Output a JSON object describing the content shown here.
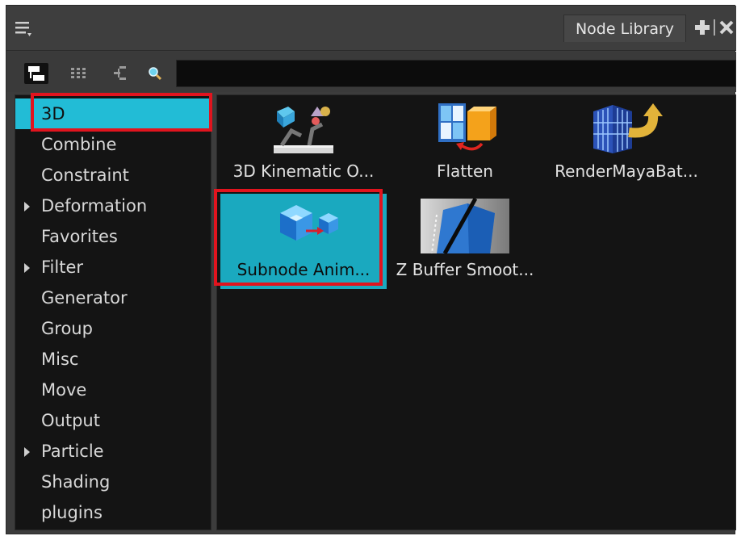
{
  "window": {
    "tab_title": "Node Library"
  },
  "toolbar": {
    "tree_view": "tree-view-icon",
    "list_view": "list-view-icon",
    "hierarchy_view": "hierarchy-view-icon",
    "search": "search-icon",
    "search_value": ""
  },
  "categories": [
    {
      "label": "3D",
      "expandable": false,
      "selected": true
    },
    {
      "label": "Combine",
      "expandable": false
    },
    {
      "label": "Constraint",
      "expandable": false
    },
    {
      "label": "Deformation",
      "expandable": true
    },
    {
      "label": "Favorites",
      "expandable": false
    },
    {
      "label": "Filter",
      "expandable": true
    },
    {
      "label": "Generator",
      "expandable": false
    },
    {
      "label": "Group",
      "expandable": false
    },
    {
      "label": "Misc",
      "expandable": false
    },
    {
      "label": "Move",
      "expandable": false
    },
    {
      "label": "Output",
      "expandable": false
    },
    {
      "label": "Particle",
      "expandable": true
    },
    {
      "label": "Shading",
      "expandable": false
    },
    {
      "label": "plugins",
      "expandable": false
    }
  ],
  "nodes": [
    {
      "label": "3D Kinematic O...",
      "icon": "kinematic-node-icon"
    },
    {
      "label": "Flatten",
      "icon": "flatten-node-icon"
    },
    {
      "label": "RenderMayaBat...",
      "icon": "render-maya-batch-icon"
    },
    {
      "label": "Subnode Anim...",
      "icon": "subnode-animation-icon",
      "selected": true
    },
    {
      "label": "Z Buffer Smoot...",
      "icon": "z-buffer-smooth-icon"
    }
  ],
  "colors": {
    "selection": "#22bcd6",
    "highlight_border": "#e1141e",
    "panel_background": "#141414"
  }
}
